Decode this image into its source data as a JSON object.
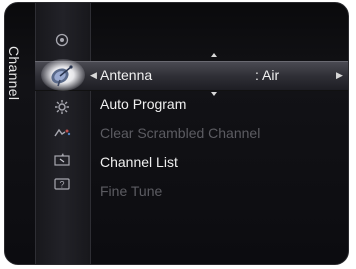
{
  "category": {
    "label": "Channel"
  },
  "icons": [
    {
      "name": "picture-icon",
      "selected": false
    },
    {
      "name": "channel-antenna-icon",
      "selected": true
    },
    {
      "name": "setup-gear-icon",
      "selected": false
    },
    {
      "name": "input-icon",
      "selected": false
    },
    {
      "name": "application-icon",
      "selected": false
    },
    {
      "name": "support-icon",
      "selected": false
    }
  ],
  "menu": {
    "items": [
      {
        "label": "Antenna",
        "value": ": Air",
        "selected": true,
        "enabled": true
      },
      {
        "label": "Auto Program",
        "enabled": true
      },
      {
        "label": "Clear Scrambled Channel",
        "enabled": false
      },
      {
        "label": "Channel List",
        "enabled": true
      },
      {
        "label": "Fine Tune",
        "enabled": false
      }
    ]
  },
  "colors": {
    "background": "#0c0c10",
    "highlight": "#3a3a42",
    "text": "#f0f0f0",
    "disabled_text": "#5c5c62"
  }
}
